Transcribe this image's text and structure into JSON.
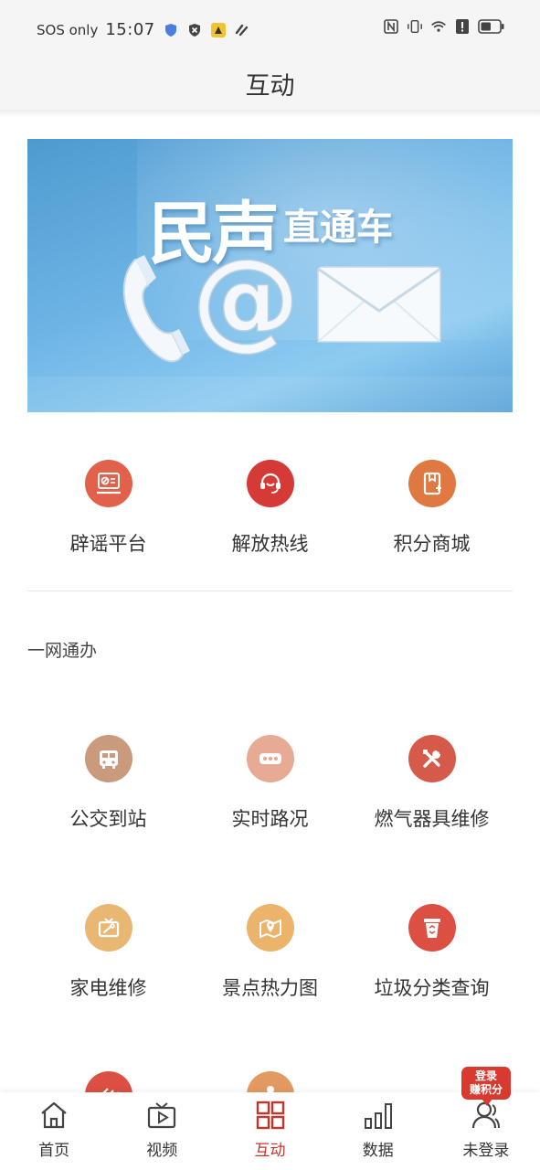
{
  "status_bar": {
    "carrier": "SOS only",
    "time": "15:07",
    "battery_level": 0.55
  },
  "header": {
    "title": "互动"
  },
  "banner": {
    "title_main": "民声",
    "title_sub": "直通车",
    "symbol": "@"
  },
  "services": [
    {
      "label": "辟谣平台",
      "icon": "rumor-board-icon",
      "color": "#e1614a"
    },
    {
      "label": "解放热线",
      "icon": "headset-icon",
      "color": "#d63a36"
    },
    {
      "label": "积分商城",
      "icon": "points-mall-icon",
      "color": "#e07841"
    }
  ],
  "section": {
    "title": "一网通办"
  },
  "grid": [
    {
      "label": "公交到站",
      "icon": "bus-icon",
      "color": "#c99a7c"
    },
    {
      "label": "实时路况",
      "icon": "traffic-icon",
      "color": "#e7aa95"
    },
    {
      "label": "燃气器具维修",
      "icon": "tools-icon",
      "color": "#d65a4a"
    },
    {
      "label": "家电维修",
      "icon": "tv-repair-icon",
      "color": "#e9b774"
    },
    {
      "label": "景点热力图",
      "icon": "map-pin-icon",
      "color": "#ebb46a"
    },
    {
      "label": "垃圾分类查询",
      "icon": "trash-icon",
      "color": "#dc4f43"
    }
  ],
  "tab_bar": {
    "tabs": [
      {
        "label": "首页",
        "icon": "home-icon"
      },
      {
        "label": "视频",
        "icon": "video-icon"
      },
      {
        "label": "互动",
        "icon": "grid-icon",
        "active": true
      },
      {
        "label": "数据",
        "icon": "bar-chart-icon"
      },
      {
        "label": "未登录",
        "icon": "user-icon"
      }
    ],
    "promo_badge": {
      "line1": "登录",
      "line2": "赚积分"
    }
  }
}
